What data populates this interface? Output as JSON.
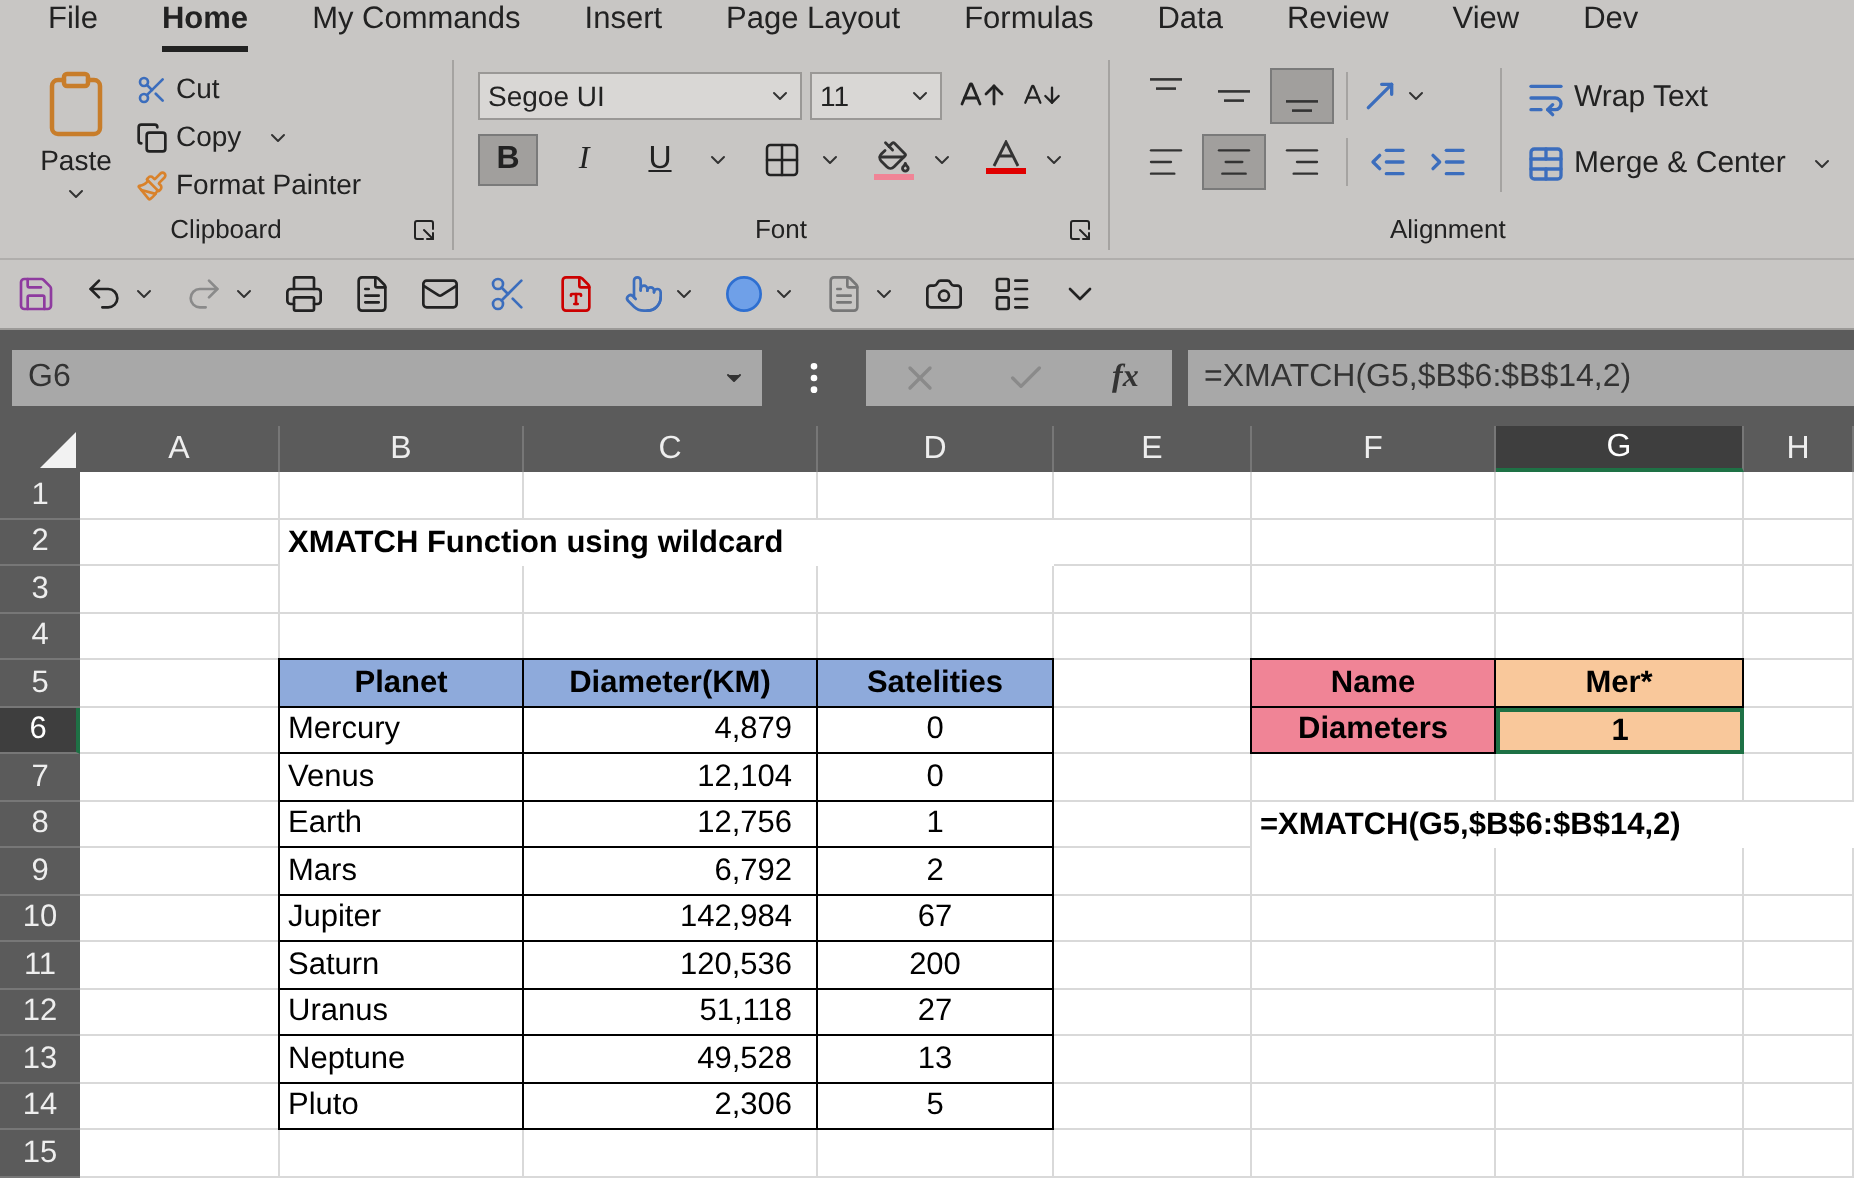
{
  "menu_tabs": [
    {
      "label": "File",
      "selected": false
    },
    {
      "label": "Home",
      "selected": true
    },
    {
      "label": "My Commands",
      "selected": false
    },
    {
      "label": "Insert",
      "selected": false
    },
    {
      "label": "Page Layout",
      "selected": false
    },
    {
      "label": "Formulas",
      "selected": false
    },
    {
      "label": "Data",
      "selected": false
    },
    {
      "label": "Review",
      "selected": false
    },
    {
      "label": "View",
      "selected": false
    },
    {
      "label": "Dev",
      "selected": false
    }
  ],
  "ribbon": {
    "clipboard": {
      "paste": "Paste",
      "cut": "Cut",
      "copy": "Copy",
      "format_painter": "Format Painter",
      "label": "Clipboard"
    },
    "font": {
      "font_name": "Segoe UI",
      "font_size": "11",
      "styles": [
        {
          "label": "B",
          "selected": true
        },
        {
          "label": "I",
          "selected": false
        },
        {
          "label": "U",
          "selected": false
        }
      ],
      "label": "Font"
    },
    "alignment": {
      "vertical": [
        {
          "kind": "top",
          "selected": false
        },
        {
          "kind": "middle",
          "selected": false
        },
        {
          "kind": "bottom",
          "selected": true
        }
      ],
      "horizontal": [
        {
          "kind": "left",
          "selected": false
        },
        {
          "kind": "center",
          "selected": true
        },
        {
          "kind": "right",
          "selected": false
        }
      ],
      "wrap_text": "Wrap Text",
      "merge_center": "Merge & Center",
      "label": "Alignment"
    }
  },
  "formula_bar": {
    "name_box": "G6",
    "fx": "fx",
    "formula": "=XMATCH(G5,$B$6:$B$14,2)"
  },
  "sheet": {
    "columns": [
      {
        "label": "A",
        "selected": false
      },
      {
        "label": "B",
        "selected": false
      },
      {
        "label": "C",
        "selected": false
      },
      {
        "label": "D",
        "selected": false
      },
      {
        "label": "E",
        "selected": false
      },
      {
        "label": "F",
        "selected": false
      },
      {
        "label": "G",
        "selected": true
      },
      {
        "label": "H",
        "selected": false
      }
    ],
    "rows": [
      {
        "label": "1",
        "selected": false
      },
      {
        "label": "2",
        "selected": false
      },
      {
        "label": "3",
        "selected": false
      },
      {
        "label": "4",
        "selected": false
      },
      {
        "label": "5",
        "selected": false
      },
      {
        "label": "6",
        "selected": true
      },
      {
        "label": "7",
        "selected": false
      },
      {
        "label": "8",
        "selected": false
      },
      {
        "label": "9",
        "selected": false
      },
      {
        "label": "10",
        "selected": false
      },
      {
        "label": "11",
        "selected": false
      },
      {
        "label": "12",
        "selected": false
      },
      {
        "label": "13",
        "selected": false
      },
      {
        "label": "14",
        "selected": false
      },
      {
        "label": "15",
        "selected": false
      }
    ],
    "title": "XMATCH Function using wildcard",
    "table": {
      "columns": [
        "Planet",
        "Diameter(KM)",
        "Satelities"
      ],
      "rows": [
        [
          "Mercury",
          "4,879",
          "0"
        ],
        [
          "Venus",
          "12,104",
          "0"
        ],
        [
          "Earth",
          "12,756",
          "1"
        ],
        [
          "Mars",
          "6,792",
          "2"
        ],
        [
          "Jupiter",
          "142,984",
          "67"
        ],
        [
          "Saturn",
          "120,536",
          "200"
        ],
        [
          "Uranus",
          "51,118",
          "27"
        ],
        [
          "Neptune",
          "49,528",
          "13"
        ],
        [
          "Pluto",
          "2,306",
          "5"
        ]
      ]
    },
    "lookup": [
      {
        "label": "Name",
        "value": "Mer*",
        "selected": false
      },
      {
        "label": "Diameters",
        "value": "1",
        "selected": true
      }
    ],
    "formula_note": "=XMATCH(G5,$B$6:$B$14,2)"
  }
}
